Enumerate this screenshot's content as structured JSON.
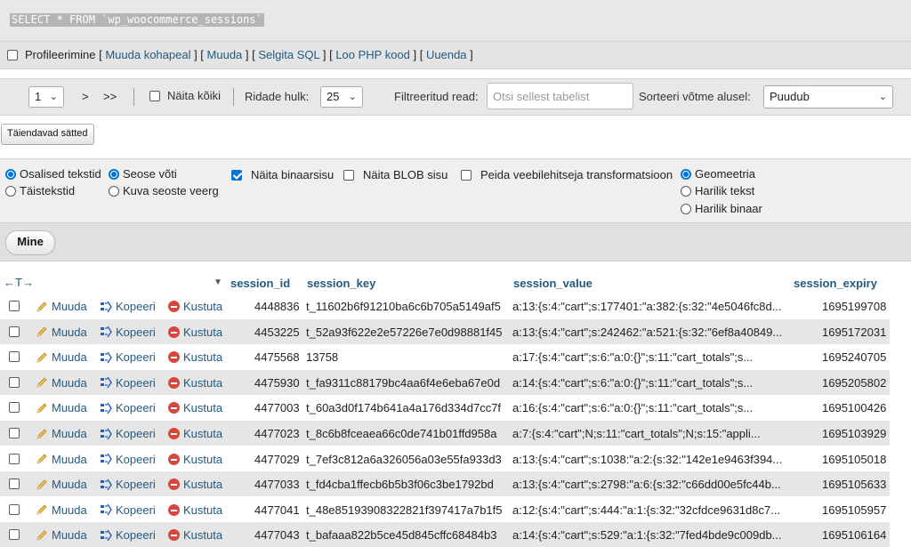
{
  "sql": {
    "query": "SELECT * FROM `wp_woocommerce_sessions`"
  },
  "profiling": {
    "label": "Profileerimine",
    "links": [
      "Muuda kohapeal",
      "Muuda",
      "Selgita SQL",
      "Loo PHP kood",
      "Uuenda"
    ]
  },
  "nav": {
    "page": "1",
    "next": ">",
    "last": ">>",
    "show_all": "Näita kõiki",
    "rows_label": "Ridade hulk:",
    "rows_value": "25",
    "filter_label": "Filtreeritud read:",
    "filter_placeholder": "Otsi sellest tabelist",
    "sort_label": "Sorteeri võtme alusel:",
    "sort_value": "Puudub"
  },
  "extra_options_button": "Täiendavad sätted",
  "options": {
    "partial_texts": "Osalised tekstid",
    "full_texts": "Täistekstid",
    "relation_key": "Seose võti",
    "relation_display": "Kuva seoste veerg",
    "show_binary": "Näita binaarsisu",
    "show_blob": "Näita BLOB sisu",
    "hide_browser_transform": "Peida veebilehitseja transformatsioon",
    "geometry": "Geomeetria",
    "wkt": "Harilik tekst",
    "wkb": "Harilik binaar"
  },
  "go_button": "Mine",
  "table": {
    "headers": {
      "arrows": "←T→",
      "session_id": "session_id",
      "session_key": "session_key",
      "session_value": "session_value",
      "session_expiry": "session_expiry"
    },
    "actions": {
      "edit": "Muuda",
      "copy": "Kopeeri",
      "delete": "Kustuta"
    },
    "rows": [
      {
        "session_id": "4448836",
        "session_key": "t_11602b6f91210ba6c6b705a5149af5",
        "session_value": "a:13:{s:4:\"cart\";s:177401:\"a:382:{s:32:\"4e5046fc8d...",
        "session_expiry": "1695199708"
      },
      {
        "session_id": "4453225",
        "session_key": "t_52a93f622e2e57226e7e0d98881f45",
        "session_value": "a:13:{s:4:\"cart\";s:242462:\"a:521:{s:32:\"6ef8a40849...",
        "session_expiry": "1695172031"
      },
      {
        "session_id": "4475568",
        "session_key": "13758",
        "session_value": "a:17:{s:4:\"cart\";s:6:\"a:0:{}\";s:11:\"cart_totals\";s...",
        "session_expiry": "1695240705"
      },
      {
        "session_id": "4475930",
        "session_key": "t_fa9311c88179bc4aa6f4e6eba67e0d",
        "session_value": "a:14:{s:4:\"cart\";s:6:\"a:0:{}\";s:11:\"cart_totals\";s...",
        "session_expiry": "1695205802"
      },
      {
        "session_id": "4477003",
        "session_key": "t_60a3d0f174b641a4a176d334d7cc7f",
        "session_value": "a:16:{s:4:\"cart\";s:6:\"a:0:{}\";s:11:\"cart_totals\";s...",
        "session_expiry": "1695100426"
      },
      {
        "session_id": "4477023",
        "session_key": "t_8c6b8fceaea66c0de741b01ffd958a",
        "session_value": "a:7:{s:4:\"cart\";N;s:11:\"cart_totals\";N;s:15:\"appli...",
        "session_expiry": "1695103929"
      },
      {
        "session_id": "4477029",
        "session_key": "t_7ef3c812a6a326056a03e55fa933d3",
        "session_value": "a:13:{s:4:\"cart\";s:1038:\"a:2:{s:32:\"142e1e9463f394...",
        "session_expiry": "1695105018"
      },
      {
        "session_id": "4477033",
        "session_key": "t_fd4cba1ffecb6b5b3f06c3be1792bd",
        "session_value": "a:13:{s:4:\"cart\";s:2798:\"a:6:{s:32:\"c66dd00e5fc44b...",
        "session_expiry": "1695105633"
      },
      {
        "session_id": "4477041",
        "session_key": "t_48e85193908322821f397417a7b1f5",
        "session_value": "a:12:{s:4:\"cart\";s:444:\"a:1:{s:32:\"32cfdce9631d8c7...",
        "session_expiry": "1695105957"
      },
      {
        "session_id": "4477043",
        "session_key": "t_bafaaa822b5ce45d845cffc68484b3",
        "session_value": "a:14:{s:4:\"cart\";s:529:\"a:1:{s:32:\"7fed4bde9c009db...",
        "session_expiry": "1695106164"
      }
    ]
  }
}
